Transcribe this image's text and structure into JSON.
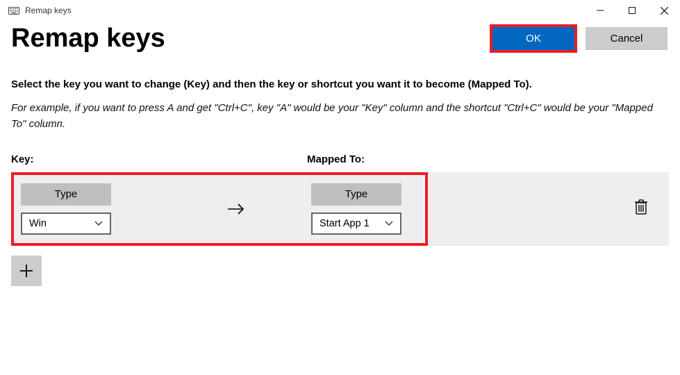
{
  "window": {
    "title": "Remap keys"
  },
  "header": {
    "page_title": "Remap keys",
    "ok_label": "OK",
    "cancel_label": "Cancel"
  },
  "text": {
    "instructions": "Select the key you want to change (Key) and then the key or shortcut you want it to become (Mapped To).",
    "example": "For example, if you want to press A and get \"Ctrl+C\", key \"A\" would be your \"Key\" column and the shortcut \"Ctrl+C\" would be your \"Mapped To\" column."
  },
  "columns": {
    "key_header": "Key:",
    "mapped_header": "Mapped To:"
  },
  "row": {
    "type_label": "Type",
    "key_value": "Win",
    "mapped_value": "Start App 1"
  }
}
